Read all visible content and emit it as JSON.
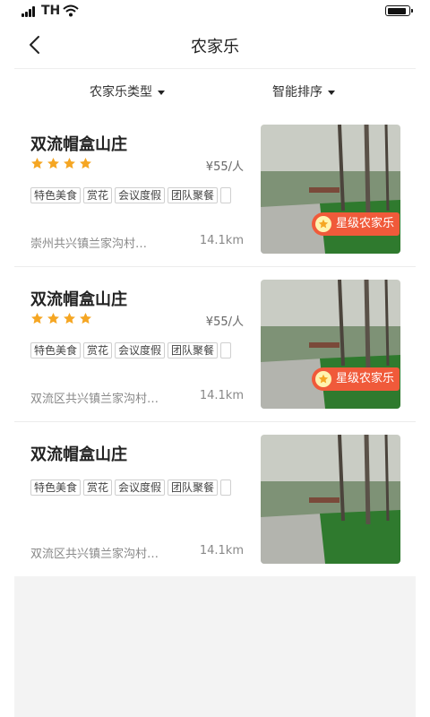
{
  "status_bar": {
    "carrier": "TH"
  },
  "nav": {
    "title": "农家乐"
  },
  "filters": {
    "type_label": "农家乐类型",
    "sort_label": "智能排序"
  },
  "listings": [
    {
      "name": "双流帽盒山庄",
      "rating": 4,
      "price": "¥55/人",
      "tags": [
        "特色美食",
        "赏花",
        "会议度假",
        "团队聚餐"
      ],
      "address": "崇州共兴镇兰家沟村…",
      "distance": "14.1km",
      "badge": "星级农家乐"
    },
    {
      "name": "双流帽盒山庄",
      "rating": 4,
      "price": "¥55/人",
      "tags": [
        "特色美食",
        "赏花",
        "会议度假",
        "团队聚餐"
      ],
      "address": "双流区共兴镇兰家沟村…",
      "distance": "14.1km",
      "badge": "星级农家乐"
    },
    {
      "name": "双流帽盒山庄",
      "tags": [
        "特色美食",
        "赏花",
        "会议度假",
        "团队聚餐"
      ],
      "address": "双流区共兴镇兰家沟村…",
      "distance": "14.1km"
    }
  ],
  "colors": {
    "accent": "#f5a623",
    "badge": "#f05a3a",
    "background": "#f3f3f3"
  }
}
